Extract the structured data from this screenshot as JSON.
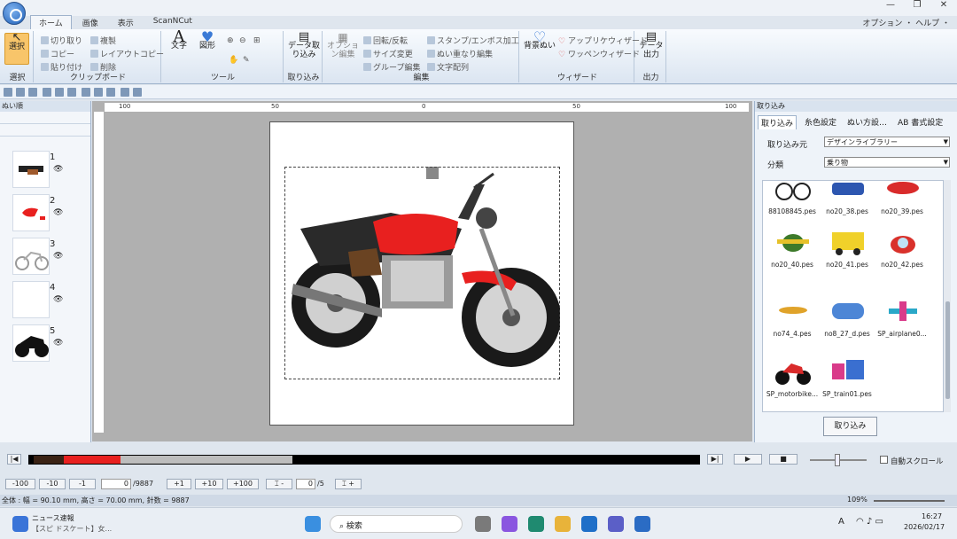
{
  "tabs": [
    "ホーム",
    "画像",
    "表示",
    "ScanNCut"
  ],
  "window_controls": [
    "—",
    "❐",
    "✕"
  ],
  "option_help": "オプション ・ ヘルプ ・",
  "ribbon": {
    "select": "選択",
    "select_group": "選択",
    "cut": "切り取り",
    "copy": "コピー",
    "paste": "貼り付け",
    "duplicate": "複製",
    "layout_copy": "レイアウトコピー",
    "delete": "削除",
    "clipboard_group": "クリップボード",
    "text": "文字",
    "shape": "図形",
    "tools_group": "ツール",
    "data_import": "データ取り込み",
    "import_group": "取り込み",
    "option_edit": "オプション編集",
    "rotate_flip": "回転/反転",
    "size_change": "サイズ変更",
    "group_edit": "グループ編集",
    "stamp": "スタンプ/エンボス加工",
    "overlap_edit": "ぬい重なり編集",
    "text_array": "文字配列",
    "edit_group": "編集",
    "fill_stitch": "背景ぬい",
    "applique_wizard": "アップリケウィザード",
    "patch_wizard": "ワッペンウィザード",
    "wizard_group": "ウィザード",
    "data_output": "データ出力",
    "output_group": "出力"
  },
  "left_panel": {
    "title": "ぬい順",
    "items": [
      {
        "number": "1"
      },
      {
        "number": "2"
      },
      {
        "number": "3"
      },
      {
        "number": "4"
      },
      {
        "number": "5"
      }
    ]
  },
  "ruler": {
    "labels": [
      "100",
      "50",
      "0",
      "50",
      "100"
    ]
  },
  "right_panel": {
    "title": "取り込み",
    "tabs": [
      "取り込み",
      "糸色設定",
      "ぬい方設…",
      "AB 書式設定"
    ],
    "source_label": "取り込み元",
    "source_value": "デザインライブラリー",
    "category_label": "分類",
    "category_value": "乗り物",
    "library": [
      "88108845.pes",
      "no20_38.pes",
      "no20_39.pes",
      "no20_40.pes",
      "no20_41.pes",
      "no20_42.pes",
      "no74_4.pes",
      "no8_27_d.pes",
      "SP_airplane0...",
      "SP_motorbike...",
      "SP_train01.pes"
    ],
    "import_button": "取り込み"
  },
  "step_controls": {
    "buttons": [
      "-100",
      "-10",
      "-1",
      "+1",
      "+10",
      "+100"
    ],
    "stitch_value": "0",
    "stitch_total": "/9887",
    "color_value": "0",
    "color_total": "/5",
    "autoscroll": "自動スクロール"
  },
  "status": {
    "text": "全体 : 幅 = 90.10 mm, 高さ = 70.00 mm, 針数 = 9887",
    "zoom": "109%"
  },
  "taskbar": {
    "news_title": "ニュース速報",
    "news_sub": "【スピ ドスケート】女...",
    "search": "検索",
    "time": "16:27",
    "date": "2026/02/17",
    "ime": "A"
  },
  "colors": {
    "accent": "#2b6cc4",
    "timeline_red": "#e8201f",
    "timeline_brown": "#3a2214"
  }
}
